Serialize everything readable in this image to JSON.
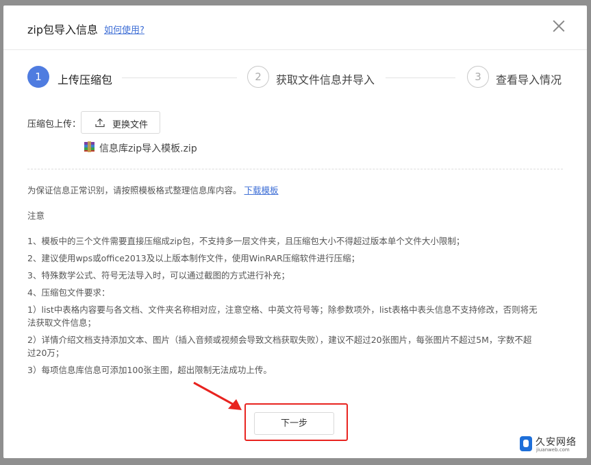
{
  "dialog": {
    "title": "zip包导入信息",
    "help_link": "如何使用?"
  },
  "steps": [
    {
      "number": "1",
      "label": "上传压缩包",
      "state": "active"
    },
    {
      "number": "2",
      "label": "获取文件信息并导入",
      "state": "inactive"
    },
    {
      "number": "3",
      "label": "查看导入情况",
      "state": "inactive"
    }
  ],
  "upload": {
    "label": "压缩包上传：",
    "button_label": "更换文件",
    "button_icon": "upload-icon",
    "file_name": "信息库zip导入模板.zip",
    "file_icon": "winrar-archive-icon"
  },
  "instructions": {
    "intro": "为保证信息正常识别，请按照模板格式整理信息库内容。",
    "download_link": "下载模板",
    "note_title": "注意",
    "lines": [
      "1、模板中的三个文件需要直接压缩成zip包，不支持多一层文件夹，且压缩包大小不得超过版本单个文件大小限制；",
      "2、建议使用wps或office2013及以上版本制作文件，使用WinRAR压缩软件进行压缩；",
      "3、特殊数学公式、符号无法导入时，可以通过截图的方式进行补充；",
      "4、压缩包文件要求：",
      "1）list中表格内容要与各文档、文件夹名称相对应，注意空格、中英文符号等；除参数项外，list表格中表头信息不支持修改，否则将无",
      "法获取文件信息；",
      "2）详情介绍文档支持添加文本、图片（插入音频或视频会导致文档获取失败），建议不超过20张图片，每张图片不超过5M，字数不超",
      "过20万；",
      "3）每项信息库信息可添加100张主图，超出限制无法成功上传。"
    ]
  },
  "footer": {
    "next_label": "下一步"
  },
  "watermark": {
    "name": "久安网络",
    "url": "jiuanweb.com"
  },
  "colors": {
    "accent": "#4f7ce0",
    "link": "#3f6fd6",
    "highlight": "#e8231f"
  }
}
